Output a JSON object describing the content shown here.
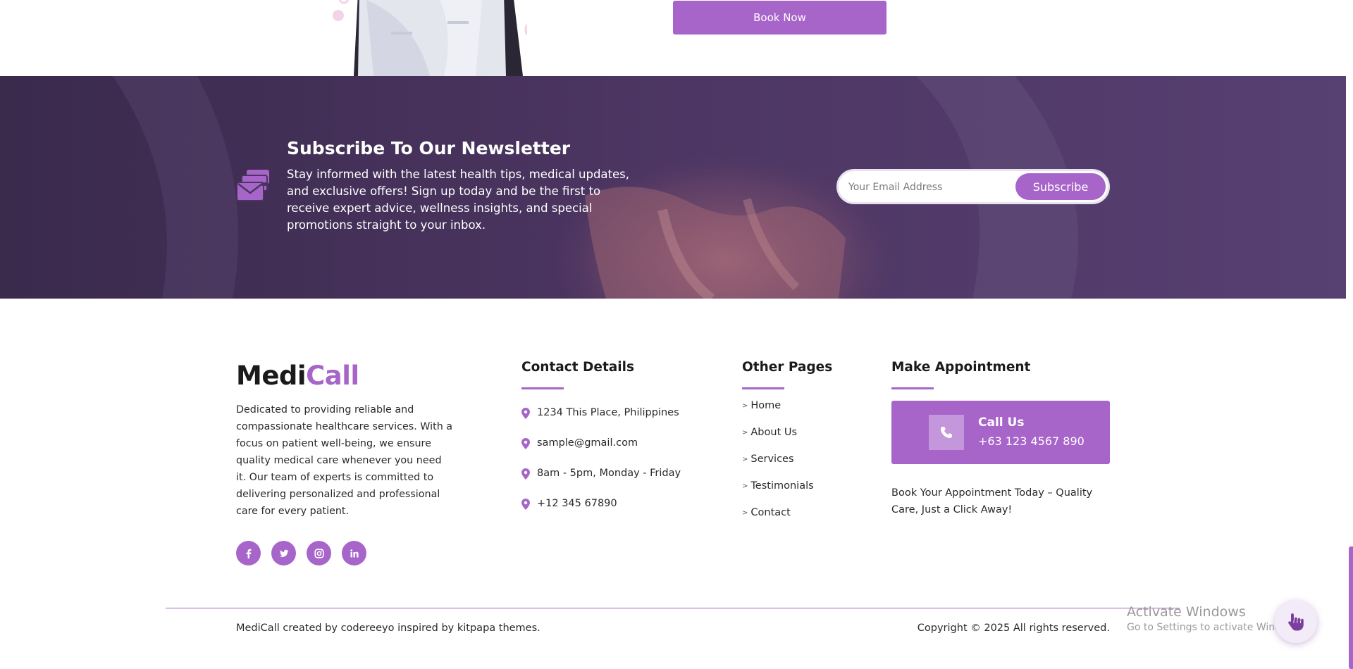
{
  "hero": {
    "book_now_label": "Book Now"
  },
  "newsletter": {
    "title": "Subscribe To Our Newsletter",
    "description": "Stay informed with the latest health tips, medical updates, and exclusive offers! Sign up today and be the first to receive expert advice, wellness insights, and special promotions straight to your inbox.",
    "email_placeholder": "Your Email Address",
    "subscribe_label": "Subscribe",
    "icon": "mail-stack-icon"
  },
  "footer": {
    "brand_part1": "Medi",
    "brand_part2": "Call",
    "about": "Dedicated to providing reliable and compassionate healthcare services. With a focus on patient well-being, we ensure quality medical care whenever you need it. Our team of experts is committed to delivering personalized and professional care for every patient.",
    "socials": [
      "facebook-icon",
      "twitter-icon",
      "instagram-icon",
      "linkedin-icon"
    ],
    "contact": {
      "title": "Contact Details",
      "items": [
        "1234 This Place, Philippines",
        "sample@gmail.com",
        "8am - 5pm, Monday - Friday",
        "+12 345 67890"
      ]
    },
    "pages": {
      "title": "Other Pages",
      "items": [
        "Home",
        "About Us",
        "Services",
        "Testimonials",
        "Contact"
      ]
    },
    "appointment": {
      "title": "Make Appointment",
      "call_title": "Call Us",
      "call_number": "+63 123 4567 890",
      "text": "Book Your Appointment Today – Quality Care, Just a Click Away!"
    },
    "credits": "MediCall created by codereeyo inspired by kitpapa themes.",
    "copyright": "Copyright © 2025 All rights reserved."
  },
  "os": {
    "activate_title": "Activate Windows",
    "activate_sub": "Go to Settings to activate Windows."
  },
  "colors": {
    "accent": "#a865c9",
    "newsletter_bg": "#4a3560"
  }
}
